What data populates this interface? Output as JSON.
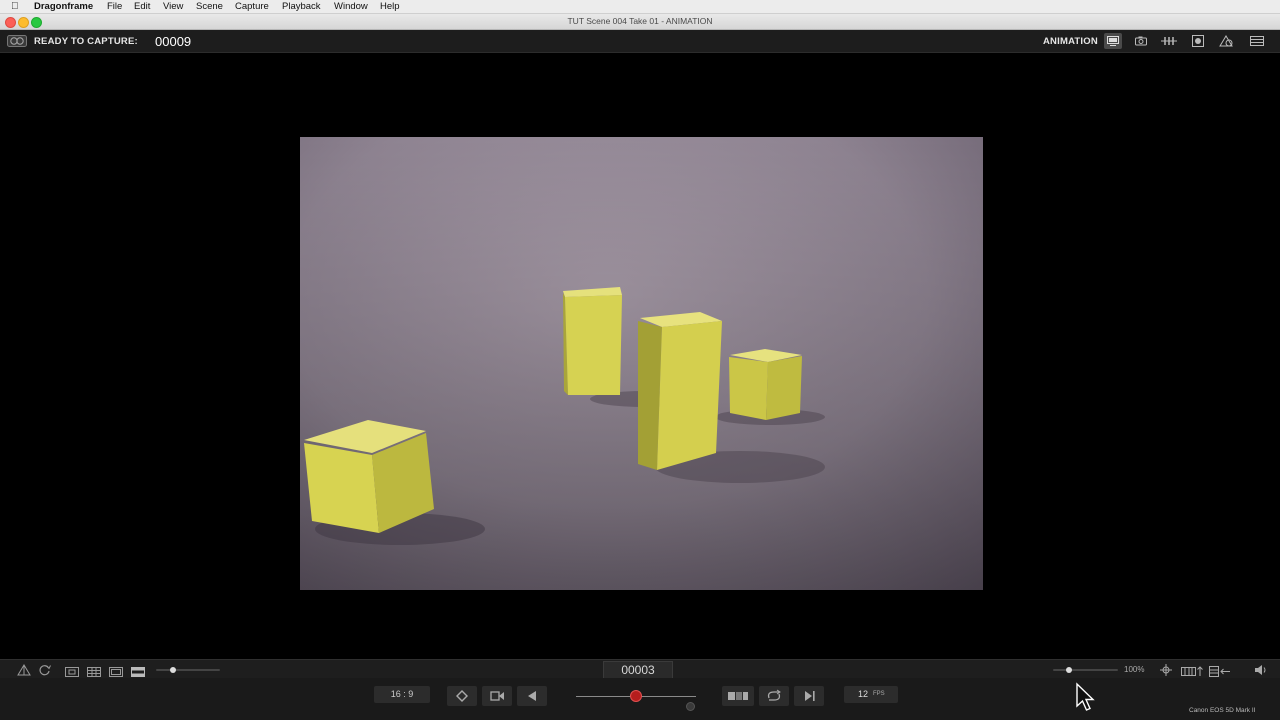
{
  "menubar": {
    "app": "Dragonframe",
    "items": [
      "File",
      "Edit",
      "View",
      "Scene",
      "Capture",
      "Playback",
      "Window",
      "Help"
    ]
  },
  "window": {
    "title": "TUT  Scene 004  Take 01 - ANIMATION"
  },
  "toolbar": {
    "status_label": "READY TO CAPTURE:",
    "frame_number": "00009",
    "mode_label": "ANIMATION"
  },
  "viewer_footer": {
    "current_frame": "00003",
    "zoom": "100%"
  },
  "transport": {
    "aspect_ratio": "16 : 9",
    "fps_value": "12",
    "fps_unit": "FPS",
    "scrubber_position": 0.5,
    "camera_label": "Canon EOS 5D Mark II"
  },
  "colors": {
    "accent_red": "#b51d1d",
    "toolbar_bg": "#1d1d1d",
    "paper": "#8f8590",
    "block_yellow": "#d7d34e"
  }
}
